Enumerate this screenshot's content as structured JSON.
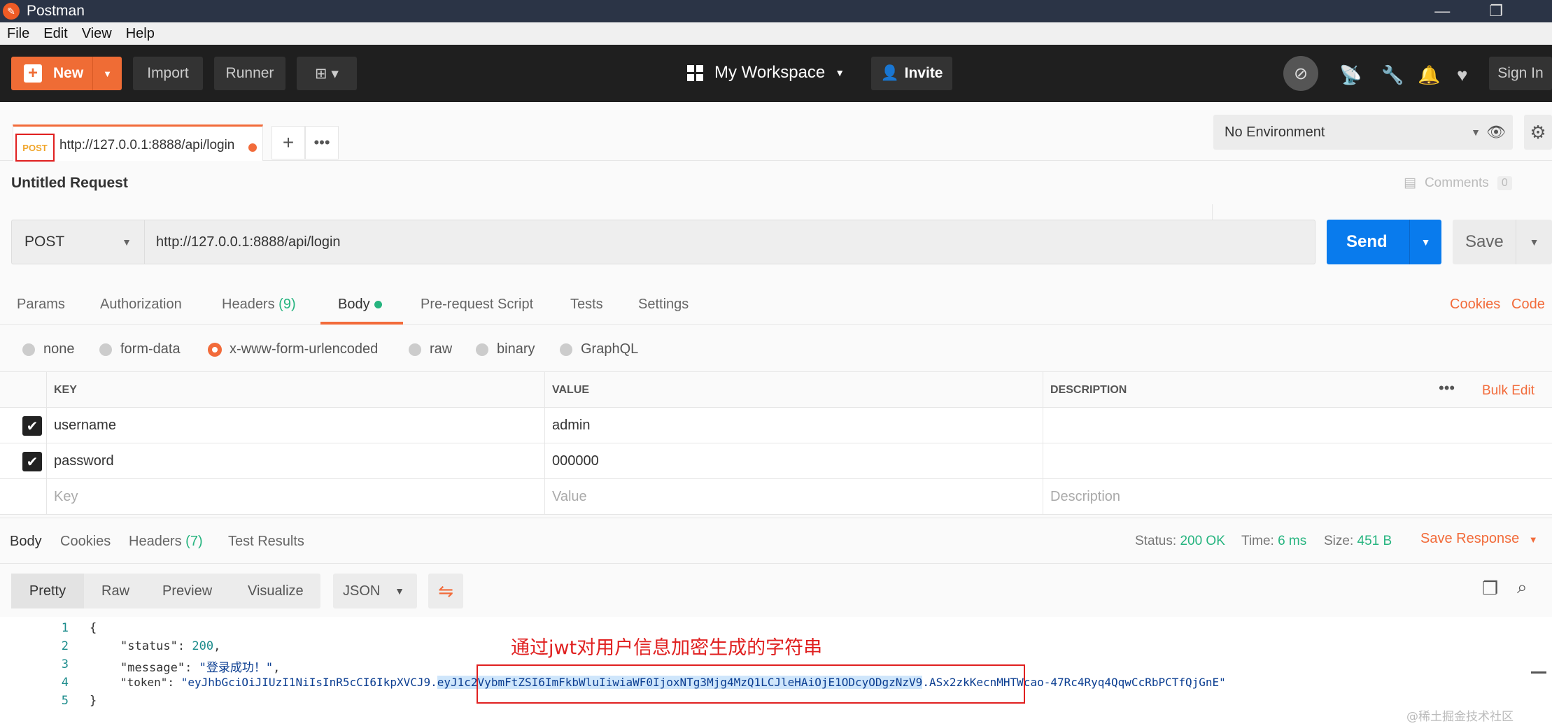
{
  "titlebar": {
    "title": "Postman",
    "minimize": "—",
    "restore": "❐",
    "close": "✕"
  },
  "menu": [
    "File",
    "Edit",
    "View",
    "Help"
  ],
  "header": {
    "new_label": "New",
    "import_label": "Import",
    "runner_label": "Runner",
    "workspace_label": "My Workspace",
    "invite_label": "Invite",
    "signin_label": "Sign In"
  },
  "tab": {
    "method": "POST",
    "url": "http://127.0.0.1:8888/api/login"
  },
  "environment": {
    "selected": "No Environment"
  },
  "request": {
    "title": "Untitled Request",
    "comments_label": "Comments",
    "comments_count": "0",
    "method": "POST",
    "url": "http://127.0.0.1:8888/api/login",
    "send_label": "Send",
    "save_label": "Save"
  },
  "request_tabs": {
    "params": "Params",
    "authorization": "Authorization",
    "headers": "Headers",
    "headers_count": "(9)",
    "body": "Body",
    "prerequest": "Pre-request Script",
    "tests": "Tests",
    "settings": "Settings",
    "cookies": "Cookies",
    "code": "Code"
  },
  "body_types": [
    "none",
    "form-data",
    "x-www-form-urlencoded",
    "raw",
    "binary",
    "GraphQL"
  ],
  "kv_table": {
    "headers": {
      "key": "KEY",
      "value": "VALUE",
      "description": "DESCRIPTION",
      "bulk_edit": "Bulk Edit"
    },
    "rows": [
      {
        "key": "username",
        "value": "admin"
      },
      {
        "key": "password",
        "value": "000000"
      }
    ],
    "placeholder": {
      "key": "Key",
      "value": "Value",
      "description": "Description"
    }
  },
  "response_tabs": {
    "body": "Body",
    "cookies": "Cookies",
    "headers": "Headers",
    "headers_count": "(7)",
    "test_results": "Test Results",
    "status_label": "Status:",
    "status_value": "200 OK",
    "time_label": "Time:",
    "time_value": "6 ms",
    "size_label": "Size:",
    "size_value": "451 B",
    "save_response": "Save Response"
  },
  "response_toolbar": {
    "pretty": "Pretty",
    "raw": "Raw",
    "preview": "Preview",
    "visualize": "Visualize",
    "format": "JSON"
  },
  "response_code": {
    "line_numbers": [
      "1",
      "2",
      "3",
      "4",
      "5"
    ],
    "open_brace": "{",
    "close_brace": "}",
    "status_key": "\"status\": ",
    "status_value": "200",
    "message_key": "\"message\": ",
    "message_value": "\"登录成功！\"",
    "token_key": "\"token\": ",
    "token_part1": "\"eyJhbGciOiJIUzI1NiIsInR5cCI6IkpXVCJ9.",
    "token_part2": "eyJ1c2VybmFtZSI6ImFkbWluIiwiaWF0IjoxNTg3Mjg4MzQ1LCJleHAiOjE1ODcyODgzNzV9",
    "token_part3": ".ASx2zkKecnMHTWcao-47Rc4Ryq4QqwCcRbPCTfQjGnE\""
  },
  "annotation": "通过jwt对用户信息加密生成的字符串",
  "watermark": "@稀土掘金技术社区"
}
